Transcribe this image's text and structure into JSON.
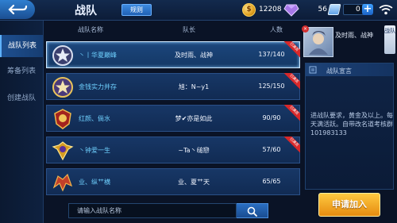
{
  "header": {
    "title": "战队",
    "rules_label": "规则",
    "coins": "12208",
    "diamonds": "56",
    "vouchers": "0",
    "plus_symbol": "+",
    "coin_symbol": "$"
  },
  "sidebar": {
    "items": [
      {
        "label": "战队列表",
        "active": true
      },
      {
        "label": "筹备列表",
        "active": false
      },
      {
        "label": "创建战队",
        "active": false
      }
    ]
  },
  "table": {
    "columns": {
      "name": "战队名称",
      "captain": "队长",
      "members": "人数"
    },
    "ribbon_text": "已满员",
    "rows": [
      {
        "name": "丶丨华夏巅峰",
        "captain": "及时雨、战神",
        "members": "137/140",
        "badge": "silver-star-badge",
        "ribbon": true,
        "selected": true
      },
      {
        "name": "金钱实力并存",
        "captain": "旭：N~y1",
        "members": "125/150",
        "badge": "gold-star-badge",
        "ribbon": true,
        "selected": false
      },
      {
        "name": "红颜、倘水",
        "captain": "梦✔亦是如此",
        "members": "90/90",
        "badge": "red-laurel-badge",
        "ribbon": true,
        "selected": false
      },
      {
        "name": "丶钟爱一生",
        "captain": "~Ta丶缒戀",
        "members": "57/60",
        "badge": "gold-winged-badge",
        "ribbon": true,
        "selected": false
      },
      {
        "name": "业、纵艹横",
        "captain": "业、夏艹天",
        "members": "65/65",
        "badge": "dragon-badge",
        "ribbon": false,
        "selected": false
      }
    ]
  },
  "detail": {
    "captain": "及时雨、战神",
    "side_tab": "战队",
    "close_symbol": "×",
    "declaration_title": "战队宣言",
    "declaration_text": "进战队要求，黄金及以上。每天满活跃。自带改名道考核群101983133"
  },
  "search": {
    "placeholder": "请输入战队名称"
  },
  "apply_label": "申请加入",
  "colors": {
    "accent": "#2f7fd0",
    "apply": "#f0a020",
    "ribbon": "#d8282a"
  }
}
